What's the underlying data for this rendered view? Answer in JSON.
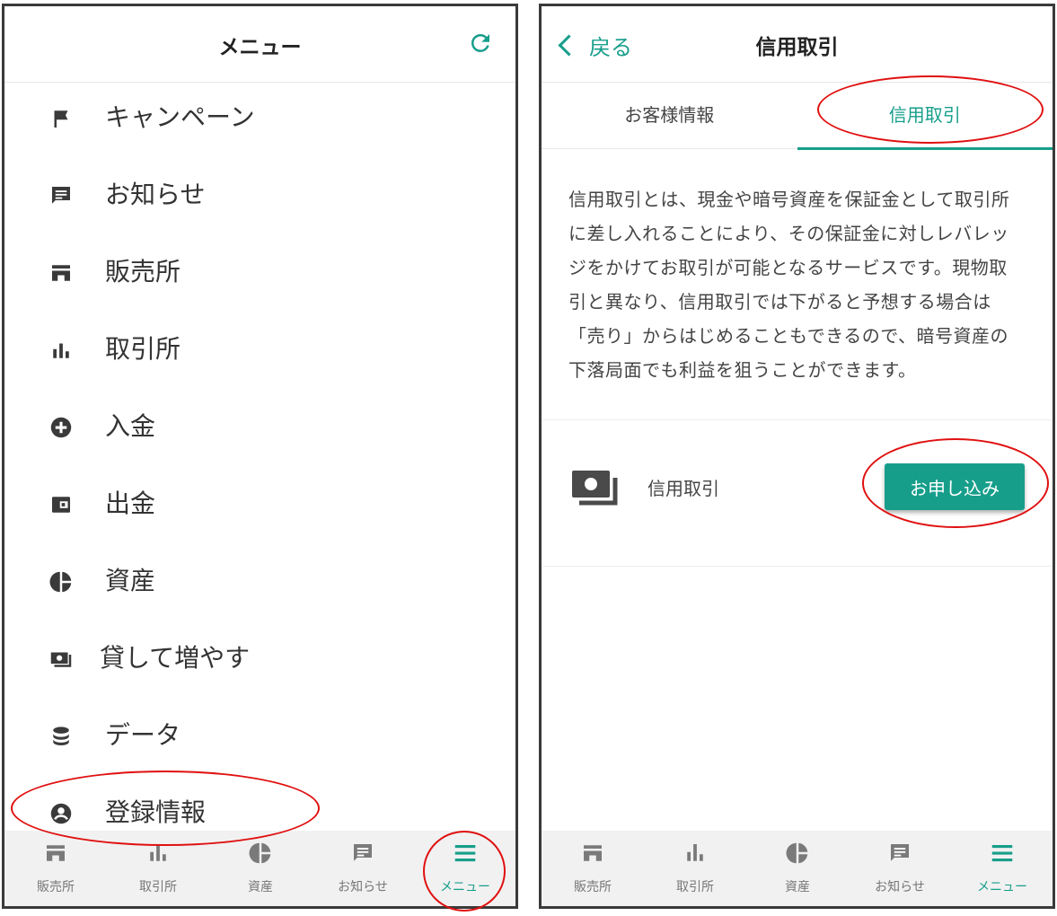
{
  "left_screen": {
    "header": {
      "title": "メニュー",
      "refresh_icon": "refresh-icon"
    },
    "menu_items": [
      {
        "label": "キャンペーン",
        "icon": "flag-icon"
      },
      {
        "label": "お知らせ",
        "icon": "message-icon"
      },
      {
        "label": "販売所",
        "icon": "store-icon"
      },
      {
        "label": "取引所",
        "icon": "bar-chart-icon"
      },
      {
        "label": "入金",
        "icon": "plus-circle-icon"
      },
      {
        "label": "出金",
        "icon": "wallet-icon"
      },
      {
        "label": "資産",
        "icon": "pie-chart-icon"
      },
      {
        "label": "貸して増やす",
        "icon": "money-icon"
      },
      {
        "label": "データ",
        "icon": "database-icon"
      },
      {
        "label": "登録情報",
        "icon": "account-circle-icon"
      }
    ],
    "tab_bar": [
      {
        "label": "販売所",
        "icon": "store-icon"
      },
      {
        "label": "取引所",
        "icon": "bar-chart-icon"
      },
      {
        "label": "資産",
        "icon": "pie-chart-icon"
      },
      {
        "label": "お知らせ",
        "icon": "message-icon"
      },
      {
        "label": "メニュー",
        "icon": "menu-icon",
        "active": true
      }
    ]
  },
  "right_screen": {
    "header": {
      "back_label": "戻る",
      "title": "信用取引"
    },
    "segments": [
      {
        "label": "お客様情報"
      },
      {
        "label": "信用取引",
        "active": true
      }
    ],
    "description": "信用取引とは、現金や暗号資産を保証金として取引所に差し入れることにより、その保証金に対しレバレッジをかけてお取引が可能となるサービスです。現物取引と異なり、信用取引では下がると予想する場合は「売り」からはじめることもできるので、暗号資産の下落局面でも利益を狙うことができます。",
    "service": {
      "label": "信用取引",
      "icon": "money-icon",
      "button_label": "お申し込み"
    },
    "tab_bar": [
      {
        "label": "販売所",
        "icon": "store-icon"
      },
      {
        "label": "取引所",
        "icon": "bar-chart-icon"
      },
      {
        "label": "資産",
        "icon": "pie-chart-icon"
      },
      {
        "label": "お知らせ",
        "icon": "message-icon"
      },
      {
        "label": "メニュー",
        "icon": "menu-icon",
        "active": true
      }
    ]
  },
  "colors": {
    "accent": "#179e8b",
    "annotation": "#e01010",
    "icon": "#3a3a3a",
    "tabbar_bg": "#f1f1f1"
  }
}
